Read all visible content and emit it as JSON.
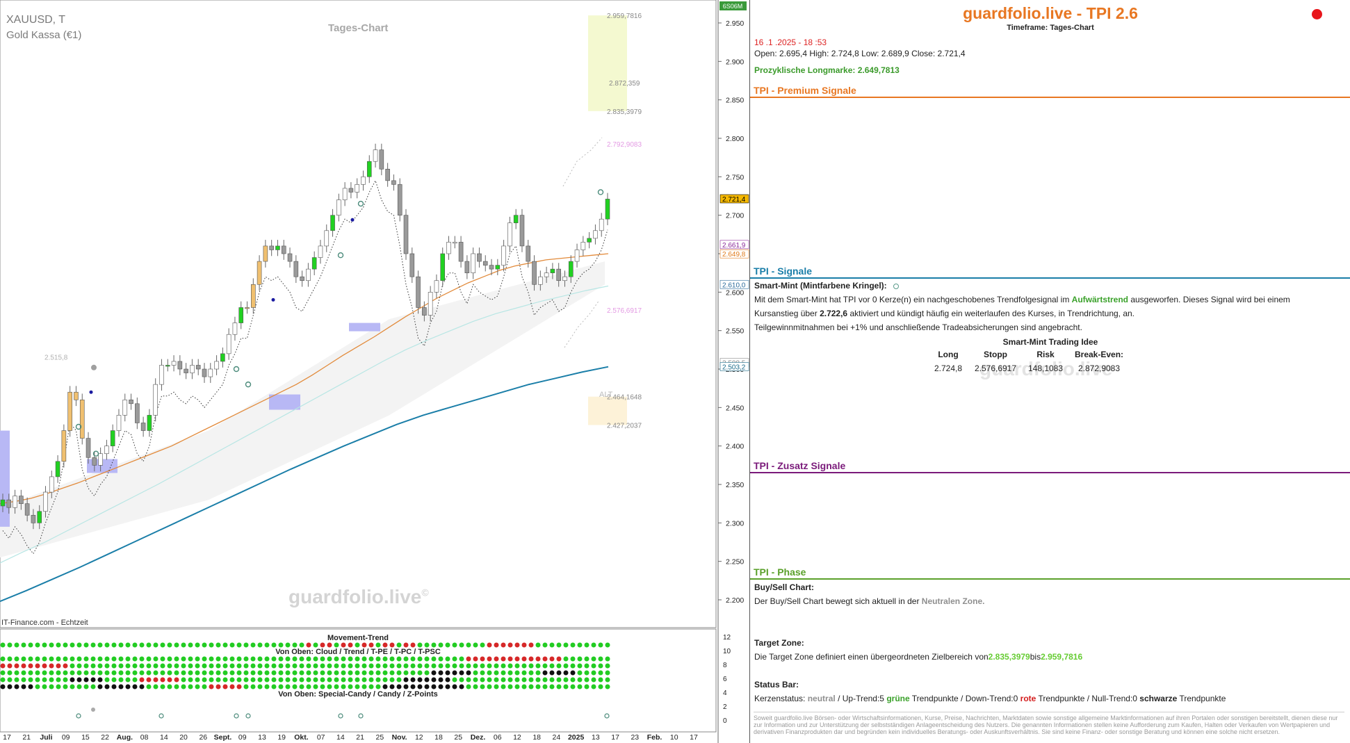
{
  "chart": {
    "symbol": "XAUUSD, T",
    "name": "Gold Kassa (€1)",
    "timeframe_label": "Tages-Chart",
    "source": "IT-Finance.com - Echtzeit",
    "watermark": "guardfolio.live",
    "watermark_mark": "©",
    "corner_tag": "6S06M",
    "alt_label": "ALT",
    "left_level_label": "2.515,8",
    "subchart_title": "Movement-Trend",
    "subchart_sub1": "Von Oben: Cloud / Trend / T-PE / T-PC / T-PSC",
    "subchart_sub2": "Von Oben: Special-Candy / Candy / Z-Points",
    "zone_labels": [
      "2.959,7816",
      "2.872,359",
      "2.835,3979",
      "2.792,9083",
      "2.576,6917",
      "2.464,1648",
      "2.427,2037"
    ],
    "price_tags": [
      {
        "label": "2.721,4",
        "value": 2721.4,
        "bg": "#f5b800",
        "fg": "#000000"
      },
      {
        "label": "2.661,9",
        "value": 2661.9,
        "bg": "#ffffff",
        "fg": "#8a2a9a"
      },
      {
        "label": "2.649,8",
        "value": 2649.8,
        "bg": "#ffffff",
        "fg": "#e07a1a"
      },
      {
        "label": "2.610,0",
        "value": 2610.0,
        "bg": "#ffffff",
        "fg": "#2a6a9a"
      },
      {
        "label": "2.508,5",
        "value": 2508.5,
        "bg": "#ffffff",
        "fg": "#888888"
      },
      {
        "label": "2.503,2",
        "value": 2503.2,
        "bg": "#ffffff",
        "fg": "#1a6a8a"
      }
    ],
    "sub_axis": [
      "12",
      "10",
      "8",
      "6",
      "4",
      "2",
      "0"
    ],
    "x_ticks": [
      "17",
      "21",
      "Juli",
      "09",
      "15",
      "22",
      "Aug.",
      "08",
      "14",
      "20",
      "26",
      "Sept.",
      "09",
      "13",
      "19",
      "Okt.",
      "07",
      "14",
      "21",
      "25",
      "Nov.",
      "12",
      "18",
      "25",
      "Dez.",
      "06",
      "12",
      "18",
      "24",
      "2025",
      "13",
      "17",
      "23",
      "Feb.",
      "10",
      "17"
    ]
  },
  "chart_data": {
    "type": "line",
    "title": "Tages-Chart",
    "xlabel": "",
    "ylabel": "",
    "ylim": [
      2175,
      2985
    ],
    "y_ticks": [
      "2.950",
      "2.900",
      "2.850",
      "2.800",
      "2.750",
      "2.700",
      "2.650",
      "2.600",
      "2.550",
      "2.500",
      "2.450",
      "2.400",
      "2.350",
      "2.300",
      "2.250",
      "2.200"
    ],
    "y_tick_values": [
      2950,
      2900,
      2850,
      2800,
      2750,
      2700,
      2650,
      2600,
      2550,
      2500,
      2450,
      2400,
      2350,
      2300,
      2250,
      2200
    ],
    "close_series": [
      2330,
      2320,
      2335,
      2325,
      2310,
      2300,
      2315,
      2340,
      2360,
      2380,
      2420,
      2470,
      2460,
      2410,
      2385,
      2375,
      2390,
      2400,
      2420,
      2440,
      2460,
      2455,
      2430,
      2420,
      2440,
      2480,
      2505,
      2505,
      2510,
      2500,
      2495,
      2505,
      2500,
      2490,
      2500,
      2510,
      2520,
      2545,
      2560,
      2580,
      2580,
      2610,
      2640,
      2660,
      2655,
      2660,
      2650,
      2640,
      2620,
      2615,
      2630,
      2645,
      2660,
      2680,
      2700,
      2720,
      2735,
      2730,
      2740,
      2750,
      2770,
      2785,
      2760,
      2745,
      2740,
      2700,
      2650,
      2620,
      2580,
      2570,
      2600,
      2615,
      2650,
      2665,
      2665,
      2640,
      2625,
      2650,
      2640,
      2635,
      2630,
      2635,
      2660,
      2690,
      2700,
      2660,
      2640,
      2610,
      2620,
      2625,
      2630,
      2615,
      2620,
      2640,
      2655,
      2665,
      2670,
      2680,
      2695,
      2721
    ],
    "series": [
      {
        "name": "",
        "values": [
          2325,
          2328,
          2332,
          2338,
          2345,
          2352,
          2360,
          2368,
          2376,
          2384,
          2392,
          2400,
          2410,
          2420,
          2430,
          2440,
          2450,
          2460,
          2470,
          2480,
          2492,
          2505,
          2518,
          2530,
          2542,
          2555,
          2568,
          2580,
          2592,
          2602,
          2612,
          2620,
          2628,
          2634,
          2638,
          2642,
          2644,
          2646,
          2648,
          2650
        ]
      },
      {
        "name": "",
        "values": [
          2248,
          2262,
          2275,
          2290,
          2305,
          2320,
          2335,
          2350,
          2366,
          2382,
          2398,
          2414,
          2430,
          2446,
          2462,
          2478,
          2494,
          2510,
          2525,
          2538,
          2550,
          2562,
          2572,
          2580,
          2588,
          2595,
          2602,
          2608
        ]
      },
      {
        "name": "",
        "values": [
          2198,
          2212,
          2227,
          2242,
          2258,
          2274,
          2290,
          2306,
          2322,
          2338,
          2354,
          2370,
          2385,
          2400,
          2414,
          2428,
          2440,
          2450,
          2460,
          2470,
          2480,
          2488,
          2496,
          2503
        ]
      }
    ],
    "buy_zone": [
      2835.3979,
      2959.7816
    ],
    "alt_zone": [
      2427.2037,
      2464.1648
    ]
  },
  "panel": {
    "brand": "guardfolio.live - TPI 2.6",
    "timeframe": "Timeframe: Tages-Chart",
    "timestamp": "16 .1 .2025  - 18 :53",
    "ohlc": "Open:  2.695,4     High:  2.724,8      Low:   2.689,9      Close:  2.721,4",
    "longmark_label": "Prozyklische Longmarke:",
    "longmark_value": "2.649,7813",
    "sec_premium": "TPI - Premium Signale",
    "sec_signale": "TPI - Signale",
    "sec_zusatz": "TPI - Zusatz Signale",
    "sec_phase": "TPI - Phase",
    "smart_mint_label": "Smart-Mint (Mintfarbene Kringel):",
    "sm_text1_a": "Mit dem Smart-Mint hat TPI vor 0  Kerze(n) ein nachgeschobenes Trendfolgesignal im ",
    "sm_text1_b": "Aufwärtstrend",
    "sm_text1_c": " ausgeworfen. Dieses Signal wird bei einem",
    "sm_text2_a": "Kursanstieg über ",
    "sm_text2_b": "2.722,6",
    "sm_text2_c": "   aktiviert und kündigt häufig ein weiterlaufen des Kurses, in Trendrichtung, an.",
    "sm_text3": "Teilgewinnmitnahmen bei +1% und anschließende Tradeabsicherungen sind angebracht.",
    "idea_title": "Smart-Mint Trading Idee",
    "idea_headers": [
      "Long",
      "Stopp",
      "Risk",
      "Break-Even:"
    ],
    "idea_values": [
      "2.724,8",
      "2.576,6917",
      "148,1083",
      "2.872,9083"
    ],
    "panel_watermark": "guardfolio.live",
    "buysell_label": "Buy/Sell Chart:",
    "buysell_text_a": "Der Buy/Sell Chart bewegt sich aktuell in der ",
    "buysell_text_b": "Neutralen Zone.",
    "target_label": "Target Zone:",
    "target_text_a": "Die Target Zone definiert einen übergeordneten Zielbereich von",
    "target_low": "2.835,3979",
    "target_mid": "bis",
    "target_high": "2.959,7816",
    "status_label": "Status Bar:",
    "status_a": "Kerzenstatus: ",
    "status_neutral": "neutral",
    "status_b": "  / Up-Trend:5 ",
    "status_green": "grüne",
    "status_c": " Trendpunkte  / Down-Trend:0 ",
    "status_red": "rote",
    "status_d": " Trendpunkte / Null-Trend:0 ",
    "status_black": "schwarze",
    "status_e": " Trendpunkte",
    "disclaimer": "Soweit guardfolio.live Börsen- oder Wirtschaftsinformationen, Kurse, Preise, Nachrichten, Marktdaten sowie sonstige allgemeine Marktinformationen auf ihren Portalen oder sonstigen bereitstellt, dienen diese nur zur Information und zur Unterstützung der selbstständigen Anlageentscheidung des Nutzers. Die genannten Informationen stellen keine Aufforderung zum Kaufen, Halten oder Verkaufen von Wertpapieren und derivativen Finanzprodukten dar und begründen kein individuelles Beratungs- oder Auskunftsverhältnis. Sie sind keine Finanz- oder sonstige Beratung und können eine solche nicht ersetzen.",
    "colors": {
      "premium": "#e87722",
      "signale": "#1a7ea8",
      "zusatz": "#7a1a7a",
      "phase": "#5aa02a"
    }
  }
}
